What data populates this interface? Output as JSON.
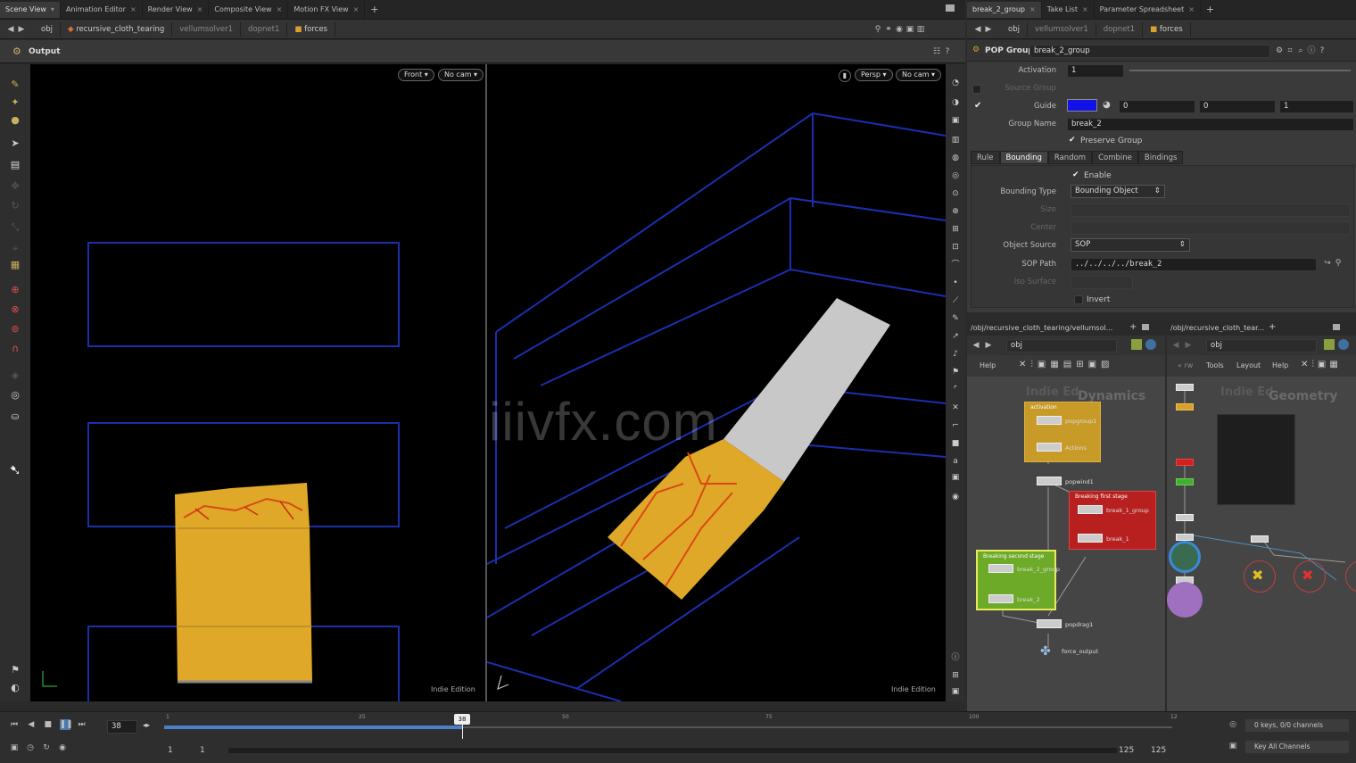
{
  "left_tabs": [
    "Scene View",
    "Animation Editor",
    "Render View",
    "Composite View",
    "Motion FX View"
  ],
  "right_tabs": [
    "break_2_group",
    "Take List",
    "Parameter Spreadsheet"
  ],
  "left_path": [
    "obj",
    "recursive_cloth_tearing",
    "vellumsolver1",
    "dopnet1",
    "forces"
  ],
  "right_path": [
    "obj",
    "vellumsolver1",
    "dopnet1",
    "forces"
  ],
  "viewport_header": "Output",
  "front_view": {
    "view_menu": "Front",
    "cam_menu": "No cam",
    "watermark": "Indie Edition"
  },
  "persp_view": {
    "view_menu": "Persp",
    "cam_menu": "No cam",
    "watermark": "Indie Edition"
  },
  "overlay_watermark": "iiivfx.com",
  "params": {
    "node_type": "POP Group",
    "node_name": "break_2_group",
    "activation_label": "Activation",
    "activation_value": "1",
    "source_group_label": "Source Group",
    "guide_label": "Guide",
    "guide_values": [
      "0",
      "0",
      "1"
    ],
    "guide_color": "#1212e8",
    "group_name_label": "Group Name",
    "group_name_value": "break_2",
    "preserve_group": "Preserve Group",
    "tabs": [
      "Rule",
      "Bounding",
      "Random",
      "Combine",
      "Bindings"
    ],
    "enable": "Enable",
    "bounding_type_label": "Bounding Type",
    "bounding_type_value": "Bounding Object",
    "size_label": "Size",
    "center_label": "Center",
    "object_source_label": "Object Source",
    "object_source_value": "SOP",
    "sop_path_label": "SOP Path",
    "sop_path_value": "../../../../break_2",
    "iso_surface_label": "Iso Surface",
    "invert": "Invert"
  },
  "network_left": {
    "path": "/obj/recursive_cloth_tearing/vellumsol...",
    "path_crumb": "obj",
    "help": "Help",
    "context": "Dynamics",
    "edition": "Indie Ed",
    "box_activation": "activation",
    "box_break_first": "Breaking first stage",
    "box_break_second": "Breaking second stage",
    "nodes": [
      "popgroup1",
      "Actions",
      "popwind1",
      "break_1_group",
      "break_1",
      "break_2_group",
      "break_2",
      "popdrag1",
      "force_output"
    ]
  },
  "network_right": {
    "path": "/obj/recursive_cloth_tear...",
    "path_crumb": "obj",
    "menu": [
      "Tools",
      "Layout",
      "Help"
    ],
    "context": "Geometry",
    "edition": "Indie Ed"
  },
  "timeline": {
    "frame": "38",
    "ticks": [
      "1",
      "25",
      "50",
      "75",
      "100",
      "12"
    ],
    "start": "1",
    "start2": "1",
    "end": "125",
    "end2": "125",
    "keys": "0 keys, 0/0 channels",
    "key_all": "Key All Channels",
    "progress": 0.296
  }
}
